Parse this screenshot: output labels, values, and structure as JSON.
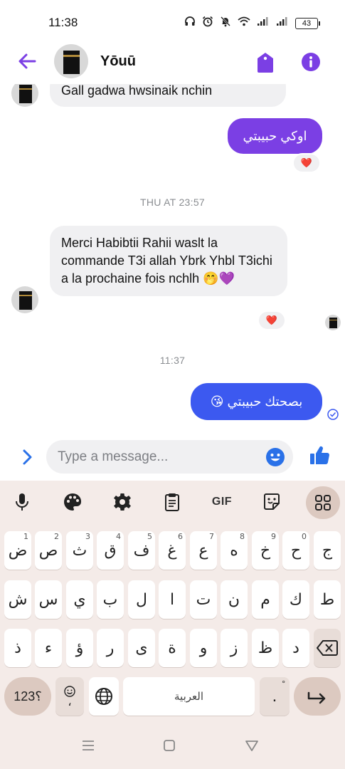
{
  "status_bar": {
    "time": "11:38",
    "battery": "43",
    "icons": [
      "headphones-icon",
      "alarm-icon",
      "mute-icon",
      "wifi-icon",
      "signal-icon",
      "signal-icon",
      "battery-icon"
    ]
  },
  "header": {
    "contact_name": "Yōuū",
    "icons": [
      "back-arrow-icon",
      "tag-icon",
      "info-icon"
    ]
  },
  "messages": [
    {
      "direction": "in",
      "text": "Gall gadwa hwsinaik nchin"
    },
    {
      "direction": "out",
      "text": "اوكي حبيبتي",
      "reaction": "❤️"
    },
    {
      "type": "timestamp",
      "text": "THU AT 23:57"
    },
    {
      "direction": "in",
      "text": "Merci Habibtii Rahii waslt la commande T3i allah Ybrk Yhbl T3ichi a la prochaine fois nchlh 🤭💜",
      "reaction": "❤️"
    },
    {
      "type": "timestamp",
      "text": "11:37"
    },
    {
      "direction": "out",
      "text": "بصحتك حبيبتي 😘",
      "status": "sent"
    }
  ],
  "composer": {
    "placeholder": "Type a message..."
  },
  "keyboard": {
    "toolbar": [
      "microphone-icon",
      "palette-icon",
      "settings-icon",
      "clipboard-icon",
      "GIF",
      "sticker-icon",
      "apps-grid-icon"
    ],
    "gif_label": "GIF",
    "row1": [
      {
        "k": "ض",
        "h": "1"
      },
      {
        "k": "ص",
        "h": "2"
      },
      {
        "k": "ث",
        "h": "3"
      },
      {
        "k": "ق",
        "h": "4"
      },
      {
        "k": "ف",
        "h": "5"
      },
      {
        "k": "غ",
        "h": "6"
      },
      {
        "k": "ع",
        "h": "7"
      },
      {
        "k": "ه",
        "h": "8"
      },
      {
        "k": "خ",
        "h": "9"
      },
      {
        "k": "ح",
        "h": "0"
      },
      {
        "k": "ج",
        "h": ""
      }
    ],
    "row2": [
      "ش",
      "س",
      "ي",
      "ب",
      "ل",
      "ا",
      "ت",
      "ن",
      "م",
      "ك",
      "ط"
    ],
    "row3": [
      "ذ",
      "ء",
      "ؤ",
      "ر",
      "ى",
      "ة",
      "و",
      "ز",
      "ظ",
      "د"
    ],
    "symbols_label": "؟123",
    "emoji_comma": "،",
    "space_label": "العربية",
    "period_label": ".",
    "period_hint": "°"
  },
  "colors": {
    "accent_purple": "#7b3fe4",
    "bubble_blue": "#3c59f0",
    "keyboard_bg": "#f4ebe8"
  }
}
